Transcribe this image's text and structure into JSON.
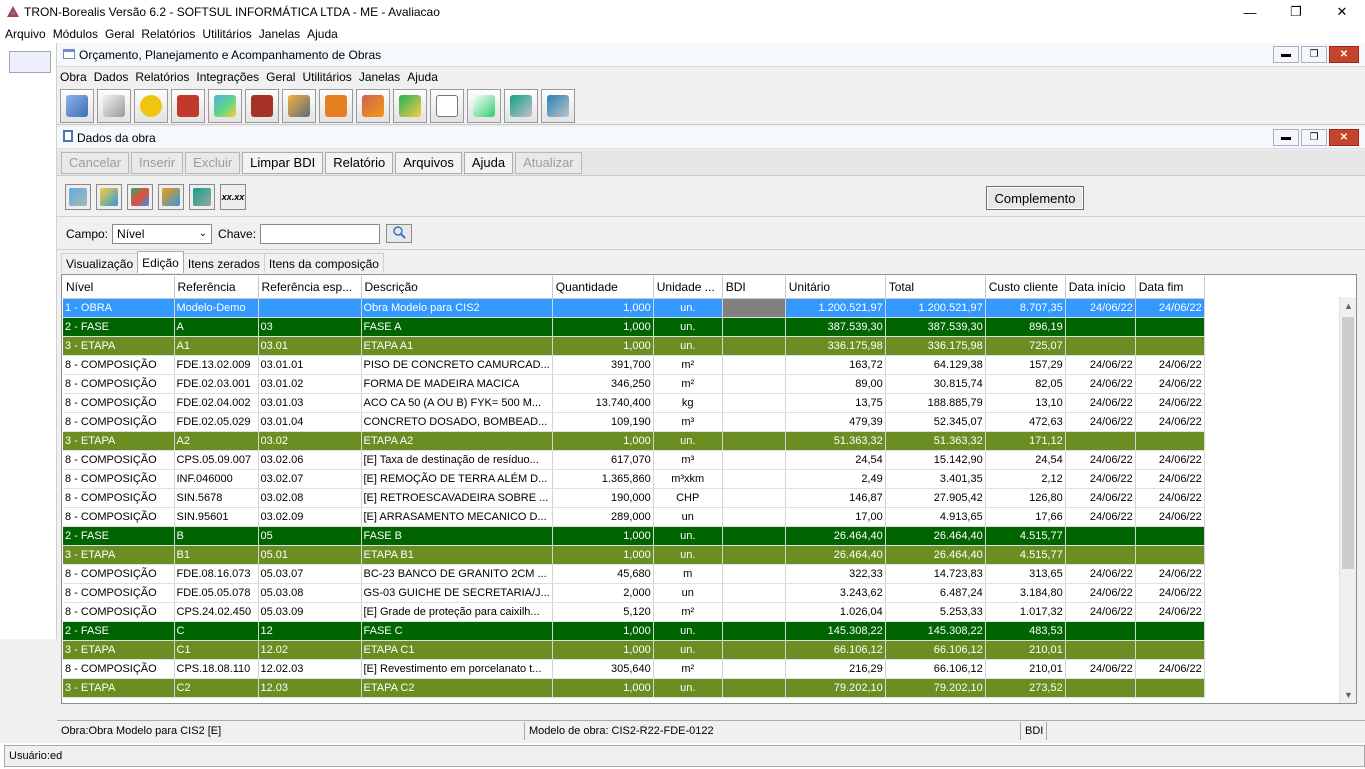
{
  "app": {
    "title": "TRON-Borealis Versão 6.2 - SOFTSUL INFORMÁTICA LTDA - ME - Avaliacao"
  },
  "main_menu": [
    "Arquivo",
    "Módulos",
    "Geral",
    "Relatórios",
    "Utilitários",
    "Janelas",
    "Ajuda"
  ],
  "inner": {
    "title": "Orçamento, Planejamento e Acompanhamento de Obras",
    "menu": [
      "Obra",
      "Dados",
      "Relatórios",
      "Integrações",
      "Geral",
      "Utilitários",
      "Janelas",
      "Ajuda"
    ]
  },
  "toolbar_icons": [
    "budget-icon",
    "drawing-compass-icon",
    "info-coin-icon",
    "bricks-icon",
    "cubes-icon",
    "wall-icon",
    "workers-icon",
    "warning-cone-icon",
    "bricks-gear-icon",
    "person-add-icon",
    "document-icon",
    "document-refresh-icon",
    "globe-box-icon",
    "globe-box-icon-2"
  ],
  "sub": {
    "title": "Dados da obra",
    "buttons": [
      {
        "label": "Cancelar",
        "enabled": false
      },
      {
        "label": "Inserir",
        "enabled": false
      },
      {
        "label": "Excluir",
        "enabled": false
      },
      {
        "label": "Limpar BDI",
        "enabled": true
      },
      {
        "label": "Relatório",
        "enabled": true
      },
      {
        "label": "Arquivos",
        "enabled": true
      },
      {
        "label": "Ajuda",
        "enabled": true
      },
      {
        "label": "Atualizar",
        "enabled": false
      }
    ],
    "icon_xx": "xx.xx",
    "complement": "Complemento"
  },
  "search": {
    "campo_label": "Campo:",
    "campo_value": "Nível",
    "chave_label": "Chave:",
    "chave_value": ""
  },
  "tabs": [
    "Visualização",
    "Edição",
    "Itens zerados",
    "Itens da composição"
  ],
  "grid": {
    "columns": [
      "Nível",
      "Referência",
      "Referência esp...",
      "Descrição",
      "Quantidade",
      "Unidade ...",
      "BDI",
      "Unitário",
      "Total",
      "Custo cliente",
      "Data início",
      "Data fim"
    ],
    "rows": [
      {
        "lv": "lv1",
        "c": [
          "1 - OBRA",
          "Modelo-Demo",
          "",
          "Obra Modelo para CIS2",
          "1,000",
          "un.",
          "",
          "1.200.521,97",
          "1.200.521,97",
          "8.707,35",
          "24/06/22",
          "24/06/22"
        ]
      },
      {
        "lv": "lv2",
        "c": [
          "2 - FASE",
          "A",
          "03",
          "FASE A",
          "1,000",
          "un.",
          "",
          "387.539,30",
          "387.539,30",
          "896,19",
          "",
          ""
        ]
      },
      {
        "lv": "lv3",
        "c": [
          "3 - ETAPA",
          "A1",
          "03.01",
          "ETAPA A1",
          "1,000",
          "un.",
          "",
          "336.175,98",
          "336.175,98",
          "725,07",
          "",
          ""
        ]
      },
      {
        "lv": "lv8",
        "c": [
          "8 - COMPOSIÇÃO",
          "FDE.13.02.009",
          "03.01.01",
          "PISO DE CONCRETO CAMURCAD...",
          "391,700",
          "m²",
          "",
          "163,72",
          "64.129,38",
          "157,29",
          "24/06/22",
          "24/06/22"
        ]
      },
      {
        "lv": "lv8",
        "c": [
          "8 - COMPOSIÇÃO",
          "FDE.02.03.001",
          "03.01.02",
          "FORMA DE MADEIRA MACICA",
          "346,250",
          "m²",
          "",
          "89,00",
          "30.815,74",
          "82,05",
          "24/06/22",
          "24/06/22"
        ]
      },
      {
        "lv": "lv8",
        "c": [
          "8 - COMPOSIÇÃO",
          "FDE.02.04.002",
          "03.01.03",
          "ACO CA 50 (A OU B) FYK= 500 M...",
          "13.740,400",
          "kg",
          "",
          "13,75",
          "188.885,79",
          "13,10",
          "24/06/22",
          "24/06/22"
        ]
      },
      {
        "lv": "lv8",
        "c": [
          "8 - COMPOSIÇÃO",
          "FDE.02.05.029",
          "03.01.04",
          "CONCRETO DOSADO, BOMBEAD...",
          "109,190",
          "m³",
          "",
          "479,39",
          "52.345,07",
          "472,63",
          "24/06/22",
          "24/06/22"
        ]
      },
      {
        "lv": "lv3",
        "c": [
          "3 - ETAPA",
          "A2",
          "03.02",
          "ETAPA A2",
          "1,000",
          "un.",
          "",
          "51.363,32",
          "51.363,32",
          "171,12",
          "",
          ""
        ]
      },
      {
        "lv": "lv8",
        "c": [
          "8 - COMPOSIÇÃO",
          "CPS.05.09.007",
          "03.02.06",
          "[E] Taxa de destinação de resíduo...",
          "617,070",
          "m³",
          "",
          "24,54",
          "15.142,90",
          "24,54",
          "24/06/22",
          "24/06/22"
        ]
      },
      {
        "lv": "lv8",
        "c": [
          "8 - COMPOSIÇÃO",
          "INF.046000",
          "03.02.07",
          "[E] REMOÇÃO DE TERRA ALÉM D...",
          "1.365,860",
          "m³xkm",
          "",
          "2,49",
          "3.401,35",
          "2,12",
          "24/06/22",
          "24/06/22"
        ]
      },
      {
        "lv": "lv8",
        "c": [
          "8 - COMPOSIÇÃO",
          "SIN.5678",
          "03.02.08",
          "[E] RETROESCAVADEIRA SOBRE ...",
          "190,000",
          "CHP",
          "",
          "146,87",
          "27.905,42",
          "126,80",
          "24/06/22",
          "24/06/22"
        ]
      },
      {
        "lv": "lv8",
        "c": [
          "8 - COMPOSIÇÃO",
          "SIN.95601",
          "03.02.09",
          "[E] ARRASAMENTO MECANICO D...",
          "289,000",
          "un",
          "",
          "17,00",
          "4.913,65",
          "17,66",
          "24/06/22",
          "24/06/22"
        ]
      },
      {
        "lv": "lv2",
        "c": [
          "2 - FASE",
          "B",
          "05",
          "FASE B",
          "1,000",
          "un.",
          "",
          "26.464,40",
          "26.464,40",
          "4.515,77",
          "",
          ""
        ]
      },
      {
        "lv": "lv3",
        "c": [
          "3 - ETAPA",
          "B1",
          "05.01",
          "ETAPA B1",
          "1,000",
          "un.",
          "",
          "26.464,40",
          "26.464,40",
          "4.515,77",
          "",
          ""
        ]
      },
      {
        "lv": "lv8",
        "c": [
          "8 - COMPOSIÇÃO",
          "FDE.08.16.073",
          "05.03.07",
          "BC-23 BANCO DE GRANITO 2CM ...",
          "45,680",
          "m",
          "",
          "322,33",
          "14.723,83",
          "313,65",
          "24/06/22",
          "24/06/22"
        ]
      },
      {
        "lv": "lv8",
        "c": [
          "8 - COMPOSIÇÃO",
          "FDE.05.05.078",
          "05.03.08",
          "GS-03 GUICHE DE SECRETARIA/J...",
          "2,000",
          "un",
          "",
          "3.243,62",
          "6.487,24",
          "3.184,80",
          "24/06/22",
          "24/06/22"
        ]
      },
      {
        "lv": "lv8",
        "c": [
          "8 - COMPOSIÇÃO",
          "CPS.24.02.450",
          "05.03.09",
          "[E] Grade de proteção para caixilh...",
          "5,120",
          "m²",
          "",
          "1.026,04",
          "5.253,33",
          "1.017,32",
          "24/06/22",
          "24/06/22"
        ]
      },
      {
        "lv": "lv2",
        "c": [
          "2 - FASE",
          "C",
          "12",
          "FASE C",
          "1,000",
          "un.",
          "",
          "145.308,22",
          "145.308,22",
          "483,53",
          "",
          ""
        ]
      },
      {
        "lv": "lv3",
        "c": [
          "3 - ETAPA",
          "C1",
          "12.02",
          "ETAPA C1",
          "1,000",
          "un.",
          "",
          "66.106,12",
          "66.106,12",
          "210,01",
          "",
          ""
        ]
      },
      {
        "lv": "lv8",
        "c": [
          "8 - COMPOSIÇÃO",
          "CPS.18.08.110",
          "12.02.03",
          "[E] Revestimento em porcelanato t...",
          "305,640",
          "m²",
          "",
          "216,29",
          "66.106,12",
          "210,01",
          "24/06/22",
          "24/06/22"
        ]
      },
      {
        "lv": "lv3",
        "c": [
          "3 - ETAPA",
          "C2",
          "12.03",
          "ETAPA C2",
          "1,000",
          "un.",
          "",
          "79.202,10",
          "79.202,10",
          "273,52",
          "",
          ""
        ]
      }
    ]
  },
  "status": {
    "obra": "Obra:Obra Modelo para CIS2 [E]",
    "modelo": "Modelo de obra: CIS2-R22-FDE-0122",
    "bdi": "BDI"
  },
  "user": "Usuário:ed",
  "colors": {
    "obra": "#3399ff",
    "fase": "#006400",
    "etapa": "#6b8e23"
  }
}
